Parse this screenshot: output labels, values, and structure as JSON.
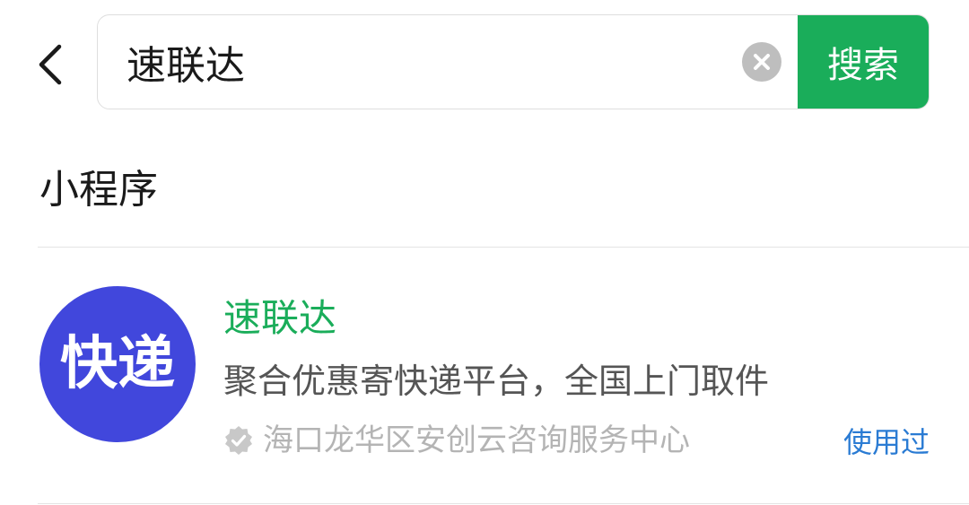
{
  "search": {
    "query": "速联达",
    "button_label": "搜索"
  },
  "section": {
    "title": "小程序"
  },
  "result": {
    "logo_text": "快递",
    "name": "速联达",
    "description": "聚合优惠寄快递平台，全国上门取件",
    "company": "海口龙华区安创云咨询服务中心",
    "used_label": "使用过"
  },
  "colors": {
    "accent_green": "#1aad5a",
    "logo_blue": "#4147dc",
    "link_blue": "#2a7bd3"
  },
  "icons": {
    "back": "chevron-left-icon",
    "clear": "clear-icon",
    "verified": "verified-badge-icon"
  }
}
